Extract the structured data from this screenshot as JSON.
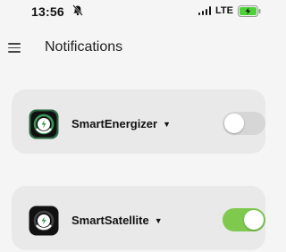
{
  "status_bar": {
    "time": "13:56",
    "network": "LTE",
    "bell_icon": "bell-slash-icon",
    "battery_icon": "battery-charging-icon",
    "battery_color": "#4cd137"
  },
  "header": {
    "menu_icon": "hamburger-menu-icon",
    "title": "Notifications"
  },
  "devices": [
    {
      "name": "SmartEnergizer",
      "caret": "▼",
      "enabled": false,
      "icon": "power-plug-icon",
      "icon_ring_color": "#3a9a5a"
    },
    {
      "name": "SmartSatellite",
      "caret": "▼",
      "enabled": true,
      "icon": "satellite-device-icon",
      "icon_ring_color": "#111111"
    }
  ],
  "colors": {
    "toggle_on": "#7ec94e",
    "toggle_off": "#d6d6d6",
    "card_bg": "#e9e9e9"
  }
}
